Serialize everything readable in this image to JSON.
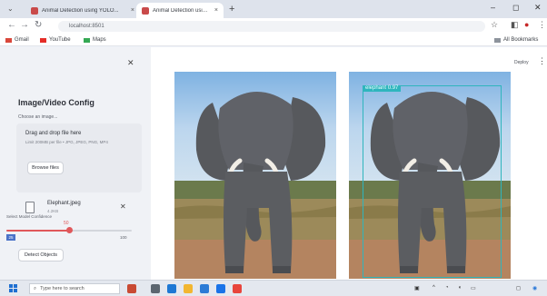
{
  "browser": {
    "tabs": [
      {
        "title": "Animal Detection using YOLO...",
        "active": false
      },
      {
        "title": "Animal Detection using YOLO...",
        "active": true
      }
    ],
    "address": "localhost:8501",
    "bookmarks": [
      "Gmail",
      "YouTube",
      "Maps"
    ],
    "all_bookmarks": "All Bookmarks"
  },
  "sidebar": {
    "title": "Image/Video Config",
    "choose_label": "Choose an image...",
    "dropzone": {
      "title": "Drag and drop file here",
      "limit": "Limit 200MB per file • JPG, JPEG, PNG, MP4"
    },
    "browse_label": "Browse files",
    "file": {
      "name": "Elephant.jpeg",
      "size": "4.2KB"
    },
    "slider": {
      "label": "Select Model Confidence",
      "value": "50",
      "min": "25",
      "max": "100",
      "fraction": 0.5
    },
    "detect_label": "Detect Objects"
  },
  "main": {
    "deploy_label": "Deploy",
    "detection": {
      "label": "elephant 0.97"
    }
  },
  "taskbar": {
    "search_placeholder": "Type here to search"
  }
}
